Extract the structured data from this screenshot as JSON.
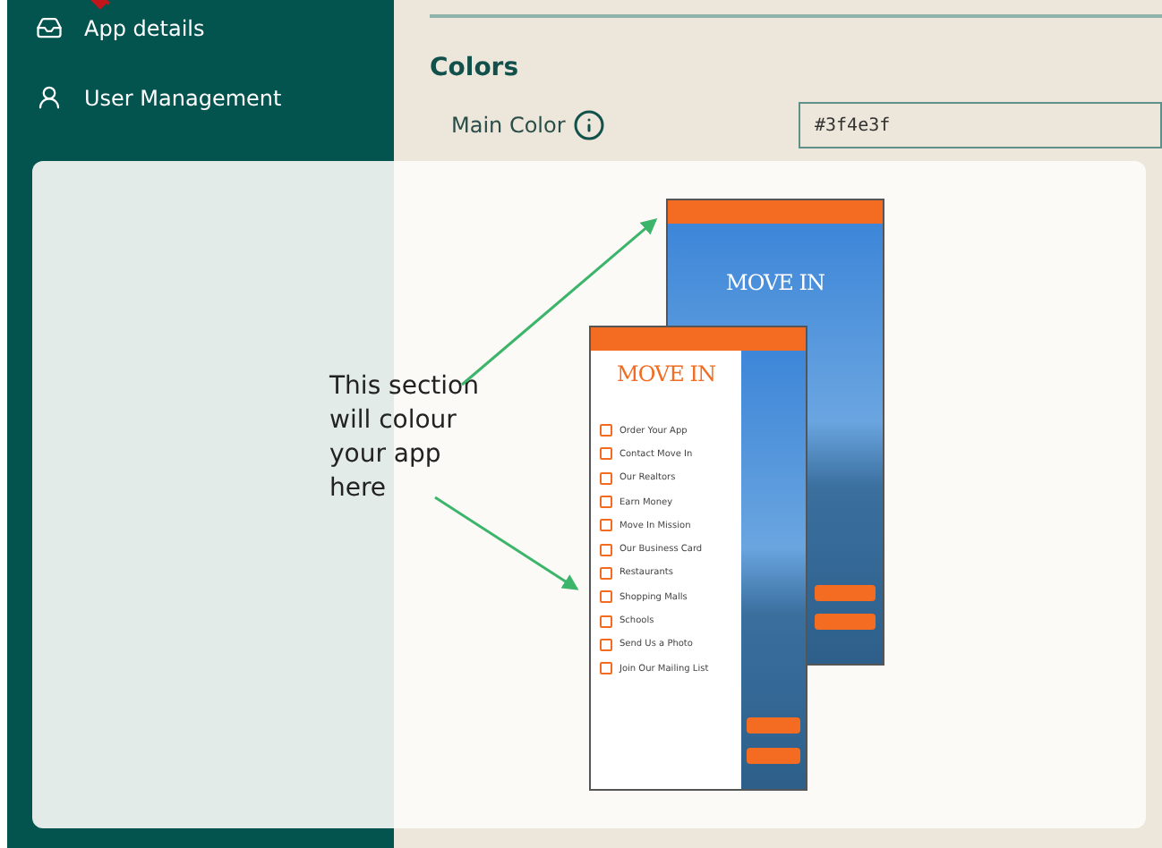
{
  "sidebar": {
    "items": [
      {
        "label": "App details"
      },
      {
        "label": "User Management"
      }
    ]
  },
  "sections": [
    {
      "title": "Colors",
      "rows": [
        {
          "label": "Main Color",
          "kind": "input",
          "info": true,
          "value": "#3f4e3f"
        }
      ]
    }
  ],
  "tooltip": {
    "text": "This section will colour your app here",
    "phones": [
      {
        "logo": "MOVE IN"
      },
      {
        "logo": "MOVE IN",
        "menu": [
          "Order Your App",
          "Contact Move In",
          "Our Realtors",
          "Earn Money",
          "Move In Mission",
          "Our Business Card",
          "Restaurants",
          "Shopping Malls",
          "Schools",
          "Send Us a Photo",
          "Join Our Mailing List"
        ]
      }
    ]
  }
}
